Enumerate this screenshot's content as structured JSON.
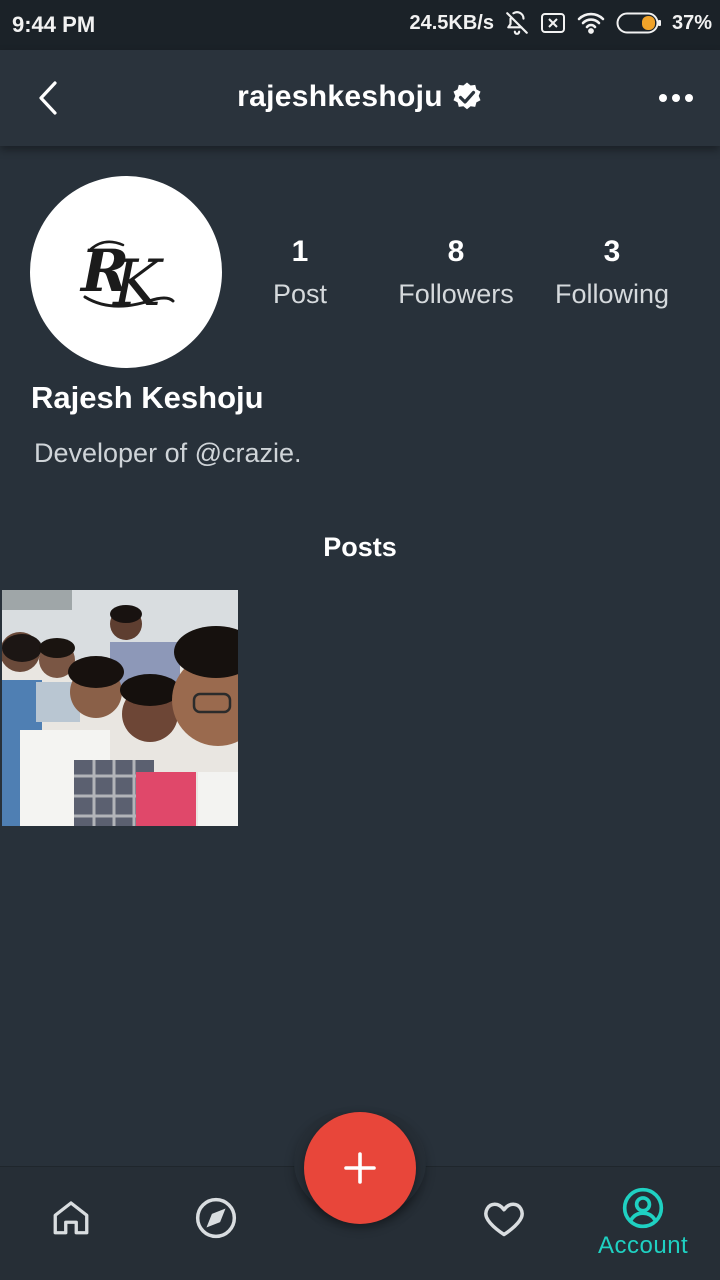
{
  "status_bar": {
    "time": "9:44 PM",
    "network_speed": "24.5KB/s",
    "battery": "37%",
    "icons": [
      "mute-icon",
      "sim-icon",
      "wifi-icon",
      "battery-icon"
    ]
  },
  "header": {
    "title": "rajeshkeshoju",
    "verified": true,
    "back_icon": "chevron-left-icon",
    "more_icon": "more-horizontal-icon"
  },
  "profile": {
    "avatar_monogram": "RK",
    "name": "Rajesh Keshoju",
    "bio": "Developer of @crazie.",
    "stats": [
      {
        "value": "1",
        "label": "Post"
      },
      {
        "value": "8",
        "label": "Followers"
      },
      {
        "value": "3",
        "label": "Following"
      }
    ]
  },
  "posts": {
    "heading": "Posts",
    "count": 1
  },
  "bottom_nav": {
    "items": [
      {
        "icon": "home-icon",
        "label": ""
      },
      {
        "icon": "compass-icon",
        "label": ""
      },
      {
        "icon": "plus-icon",
        "label": ""
      },
      {
        "icon": "heart-icon",
        "label": ""
      },
      {
        "icon": "account-icon",
        "label": "Account"
      }
    ],
    "active": "Account"
  },
  "colors": {
    "background": "#28313a",
    "header": "#2a333c",
    "status_bar": "#1b2228",
    "fab": "#e8463a",
    "accent": "#1fd1c2",
    "verified_badge": "#ffffff"
  }
}
